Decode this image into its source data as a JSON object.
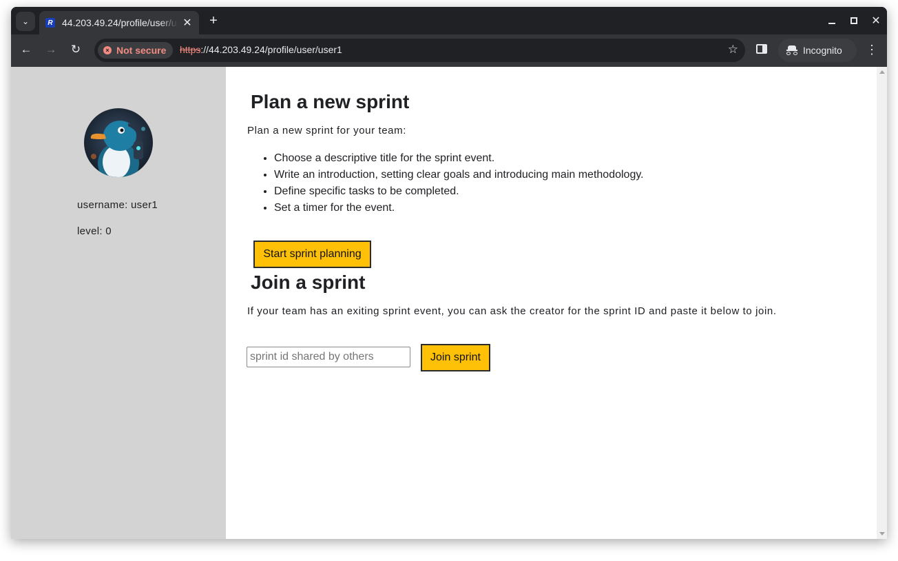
{
  "browser": {
    "tab_title": "44.203.49.24/profile/user/user1",
    "favicon_letter": "R",
    "security_chip": "Not secure",
    "url_scheme": "https",
    "url_rest": "://44.203.49.24/profile/user/user1",
    "incognito_label": "Incognito"
  },
  "sidebar": {
    "username_line": "username: user1",
    "level_line": "level: 0",
    "avatar_icon": "penguin-avatar"
  },
  "plan": {
    "heading": "Plan a new sprint",
    "intro": "Plan a new sprint for your team:",
    "steps": [
      "Choose a descriptive title for the sprint event.",
      "Write an introduction, setting clear goals and introducing main methodology.",
      "Define specific tasks to be completed.",
      "Set a timer for the event."
    ],
    "button_label": "Start sprint planning"
  },
  "join": {
    "heading": "Join a sprint",
    "description": "If your team has an exiting sprint event, you can ask the creator for the sprint ID and paste it below to join.",
    "input_placeholder": "sprint id shared by others",
    "input_value": "",
    "button_label": "Join sprint"
  },
  "colors": {
    "accent_button": "#ffc107",
    "sidebar_bg": "#d3d3d3",
    "chrome_dark": "#202124",
    "insecure_red": "#f28b82"
  }
}
